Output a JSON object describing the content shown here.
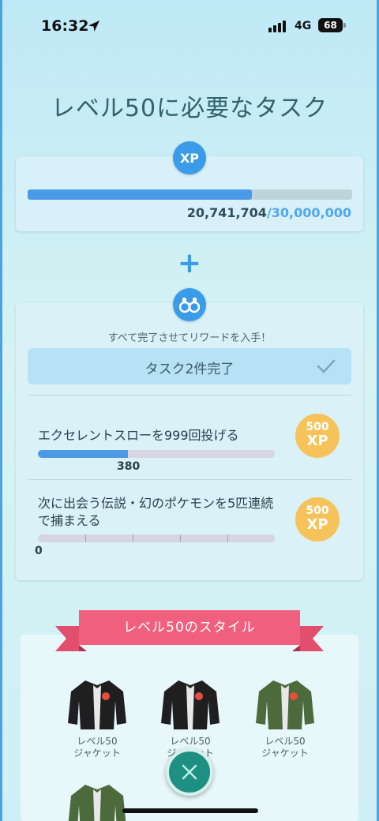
{
  "status_bar": {
    "time": "16:32",
    "network": "4G",
    "battery": "68"
  },
  "page_title": "レベル50に必要なタスク",
  "xp": {
    "badge": "XP",
    "current": "20,741,704",
    "separator": "/",
    "max": "30,000,000",
    "progress_fraction": 0.691
  },
  "plus_sign": "+",
  "tasks": {
    "hint": "すべて完了させてリワードを入手！",
    "completed_label": "タスク2件完了",
    "items": [
      {
        "title": "エクセレントスローを999回投げる",
        "progress_fraction": 0.38,
        "count": "380",
        "reward_amount": "500",
        "reward_unit": "XP"
      },
      {
        "title": "次に出会う伝説・幻のポケモンを5匹連続で捕まえる",
        "progress_fraction": 0.0,
        "count": "0",
        "reward_amount": "500",
        "reward_unit": "XP"
      }
    ]
  },
  "style_section": {
    "ribbon_label": "レベル50のスタイル",
    "items": [
      {
        "line1": "レベル50",
        "line2": "ジャケット",
        "color": "#1f1f22"
      },
      {
        "line1": "レベル50",
        "line2": "ジャケット",
        "color": "#1f1f22"
      },
      {
        "line1": "レベル50",
        "line2": "ジャケット",
        "color": "#4c6a3c"
      }
    ],
    "partial_item_color": "#4c6a3c"
  },
  "colors": {
    "accent_blue": "#3a9be8",
    "reward_gold": "#f6c25a",
    "ribbon_pink": "#f0607e",
    "close_teal": "#1e8f83"
  }
}
